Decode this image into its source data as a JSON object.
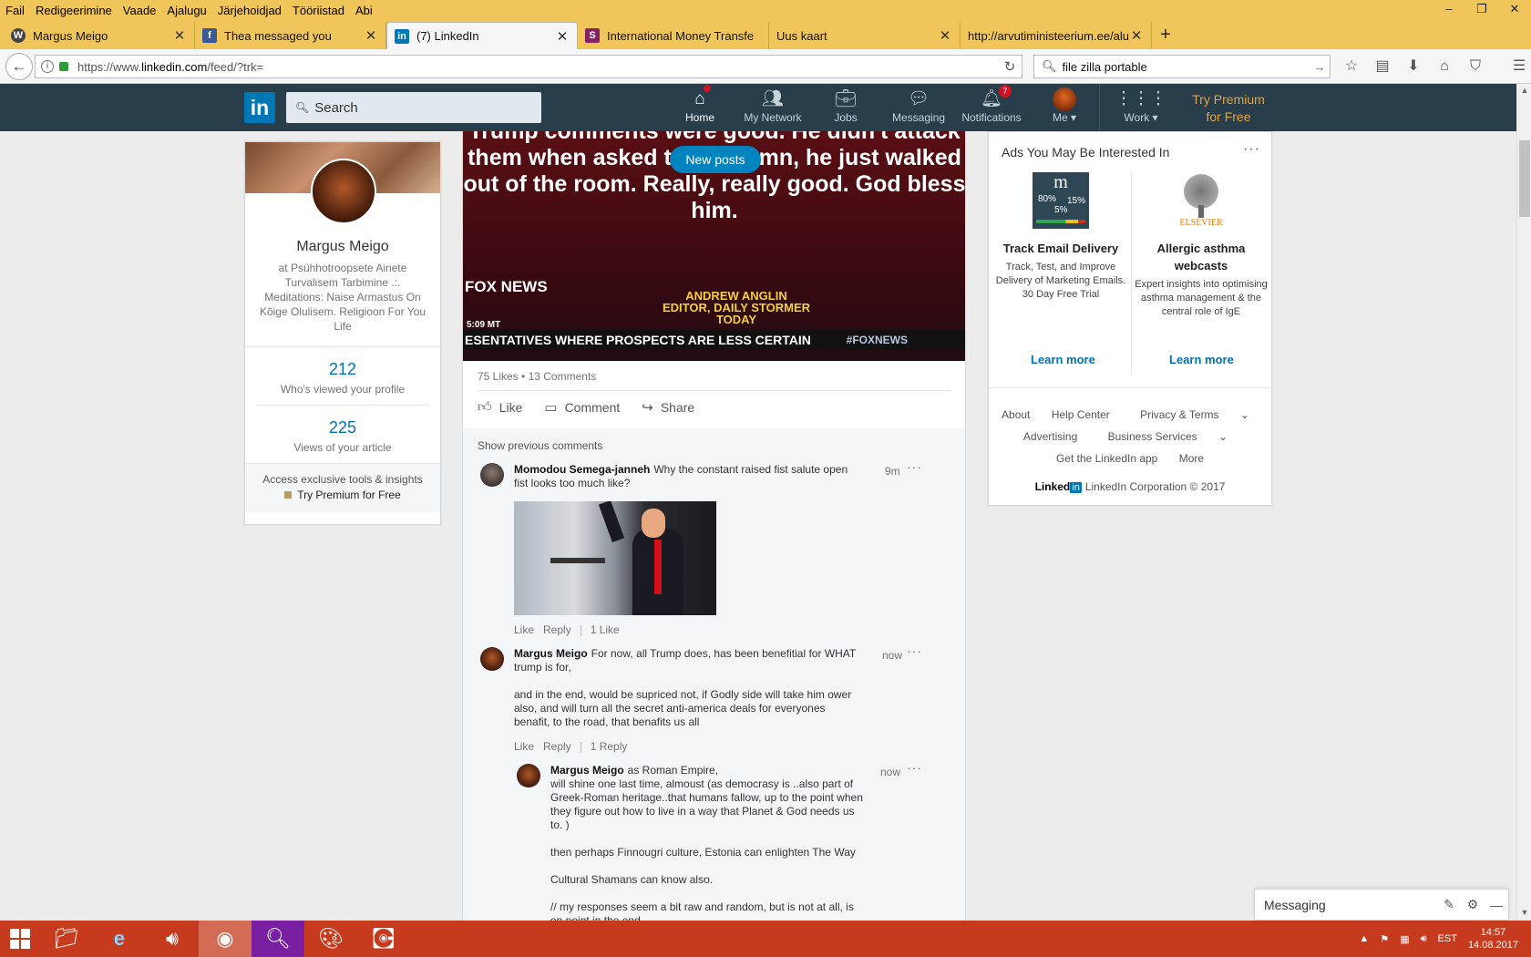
{
  "browser": {
    "menu": [
      "Fail",
      "Redigeerimine",
      "Vaade",
      "Ajalugu",
      "Järjehoidjad",
      "Tööriistad",
      "Abi"
    ],
    "tabs": [
      {
        "title": "Margus Meigo",
        "icon": "wordpress-icon",
        "color": "#444444"
      },
      {
        "title": "Thea messaged you",
        "icon": "facebook-icon",
        "color": "#3b5998"
      },
      {
        "title": "(7) LinkedIn",
        "icon": "linkedin-icon",
        "color": "#0077b5",
        "active": true
      },
      {
        "title": "International Money Transfe",
        "icon": "skrill-icon",
        "color": "#862165"
      },
      {
        "title": "Uus kaart",
        "icon": "",
        "color": ""
      },
      {
        "title": "http://arvutiministeerium.ee/alu",
        "icon": "",
        "color": ""
      }
    ],
    "url_prefix": "https://www.",
    "url_domain": "linkedin.com",
    "url_rest": "/feed/?trk=",
    "search_value": "file zilla portable"
  },
  "linkedin": {
    "search_placeholder": "Search",
    "nav": [
      {
        "label": "Home",
        "badge": "",
        "active": true
      },
      {
        "label": "My Network",
        "badge": ""
      },
      {
        "label": "Jobs",
        "badge": ""
      },
      {
        "label": "Messaging",
        "badge": ""
      },
      {
        "label": "Notifications",
        "badge": "7"
      },
      {
        "label": "Me"
      },
      {
        "label": "Work"
      }
    ],
    "premium_line1": "Try Premium",
    "premium_line2": "for Free"
  },
  "profile": {
    "name": "Margus Meigo",
    "tagline": "at Psühhotroopsete Ainete Turvalisem Tarbimine .:. Meditations: Naise Armastus On Kõige Olulisem. Religioon For You Life",
    "profile_views": "212",
    "profile_views_label": "Who's viewed your profile",
    "article_views": "225",
    "article_views_label": "Views of your article",
    "footer_a": "Access exclusive tools & insights",
    "footer_b": "Try Premium for Free"
  },
  "post": {
    "quote": "Trump comments were good. He didn't attack them when asked to condemn, he just walked out of the room. Really, really good. God bless him.",
    "new_posts": "New posts",
    "fox_logo": "FOX NEWS",
    "time": "5:09 MT",
    "lower_third_1": "ANDREW ANGLIN",
    "lower_third_2": "EDITOR, DAILY STORMER",
    "lower_third_3": "TODAY",
    "ticker": "ESENTATIVES WHERE PROSPECTS ARE LESS CERTAIN",
    "ticker_tag": "#FOXNEWS",
    "likes": "75 Likes",
    "comments_count": "13 Comments",
    "like": "Like",
    "comment": "Comment",
    "share": "Share",
    "show_previous": "Show previous comments"
  },
  "comments": [
    {
      "author": "Momodou Semega-janneh",
      "text": "Why the constant raised fist  salute open fist looks too much like?",
      "time": "9m",
      "like": "Like",
      "reply": "Reply",
      "extra": "1 Like"
    },
    {
      "author": "Margus Meigo",
      "text1": "For now, all Trump does, has been benefitial for WHAT trump is for,",
      "text2": "and in the end, would be supriced not, if Godly side will take him ower also, and will turn all the secret anti-america deals for everyones benafit, to the road, that benafits us all",
      "time": "now",
      "like": "Like",
      "reply": "Reply",
      "extra": "1 Reply"
    },
    {
      "author": "Margus Meigo",
      "text1": "as Roman Empire,",
      "text2": "will shine one last time, almoust (as democrasy is ..also part of Greek-Roman heritage..that humans fallow, up to the point when they figure out how to live in a way that Planet & God needs us to. )",
      "text3": "then perhaps Finnougri culture, Estonia can enlighten The Way",
      "text4": "Cultural Shamans can know also.",
      "text5": "// my responses seem a bit raw and random, but is not at all, is on point in the end",
      "time": "now"
    }
  ],
  "ads": {
    "title": "Ads You May Be Interested In",
    "ad1": {
      "headline": "Track Email Delivery",
      "desc": "Track, Test, and Improve Delivery of Marketing Emails. 30 Day Free Trial",
      "cta": "Learn more",
      "logo_m": "m",
      "logo_a": "80%",
      "logo_b": "15%",
      "logo_c": "5%"
    },
    "ad2": {
      "headline": "Allergic asthma webcasts",
      "desc": "Expert insights into optimising asthma management & the central role of IgE",
      "cta": "Learn more",
      "logo_text": "ELSEVIER"
    },
    "footer_links": [
      "About",
      "Help Center",
      "Privacy & Terms",
      "Advertising",
      "Business Services",
      "Get the LinkedIn app",
      "More"
    ],
    "corp_linked": "Linked",
    "corp_in": "in",
    "corp_text": "LinkedIn Corporation © 2017"
  },
  "messaging": {
    "label": "Messaging"
  },
  "taskbar": {
    "lang": "EST",
    "time": "14:57",
    "date": "14.08.2017"
  },
  "colors": {
    "linkedin_blue": "#0077b5",
    "header_bg": "#283e4a",
    "firefox_bar": "#f0c65a",
    "taskbar": "#c63a1d"
  }
}
